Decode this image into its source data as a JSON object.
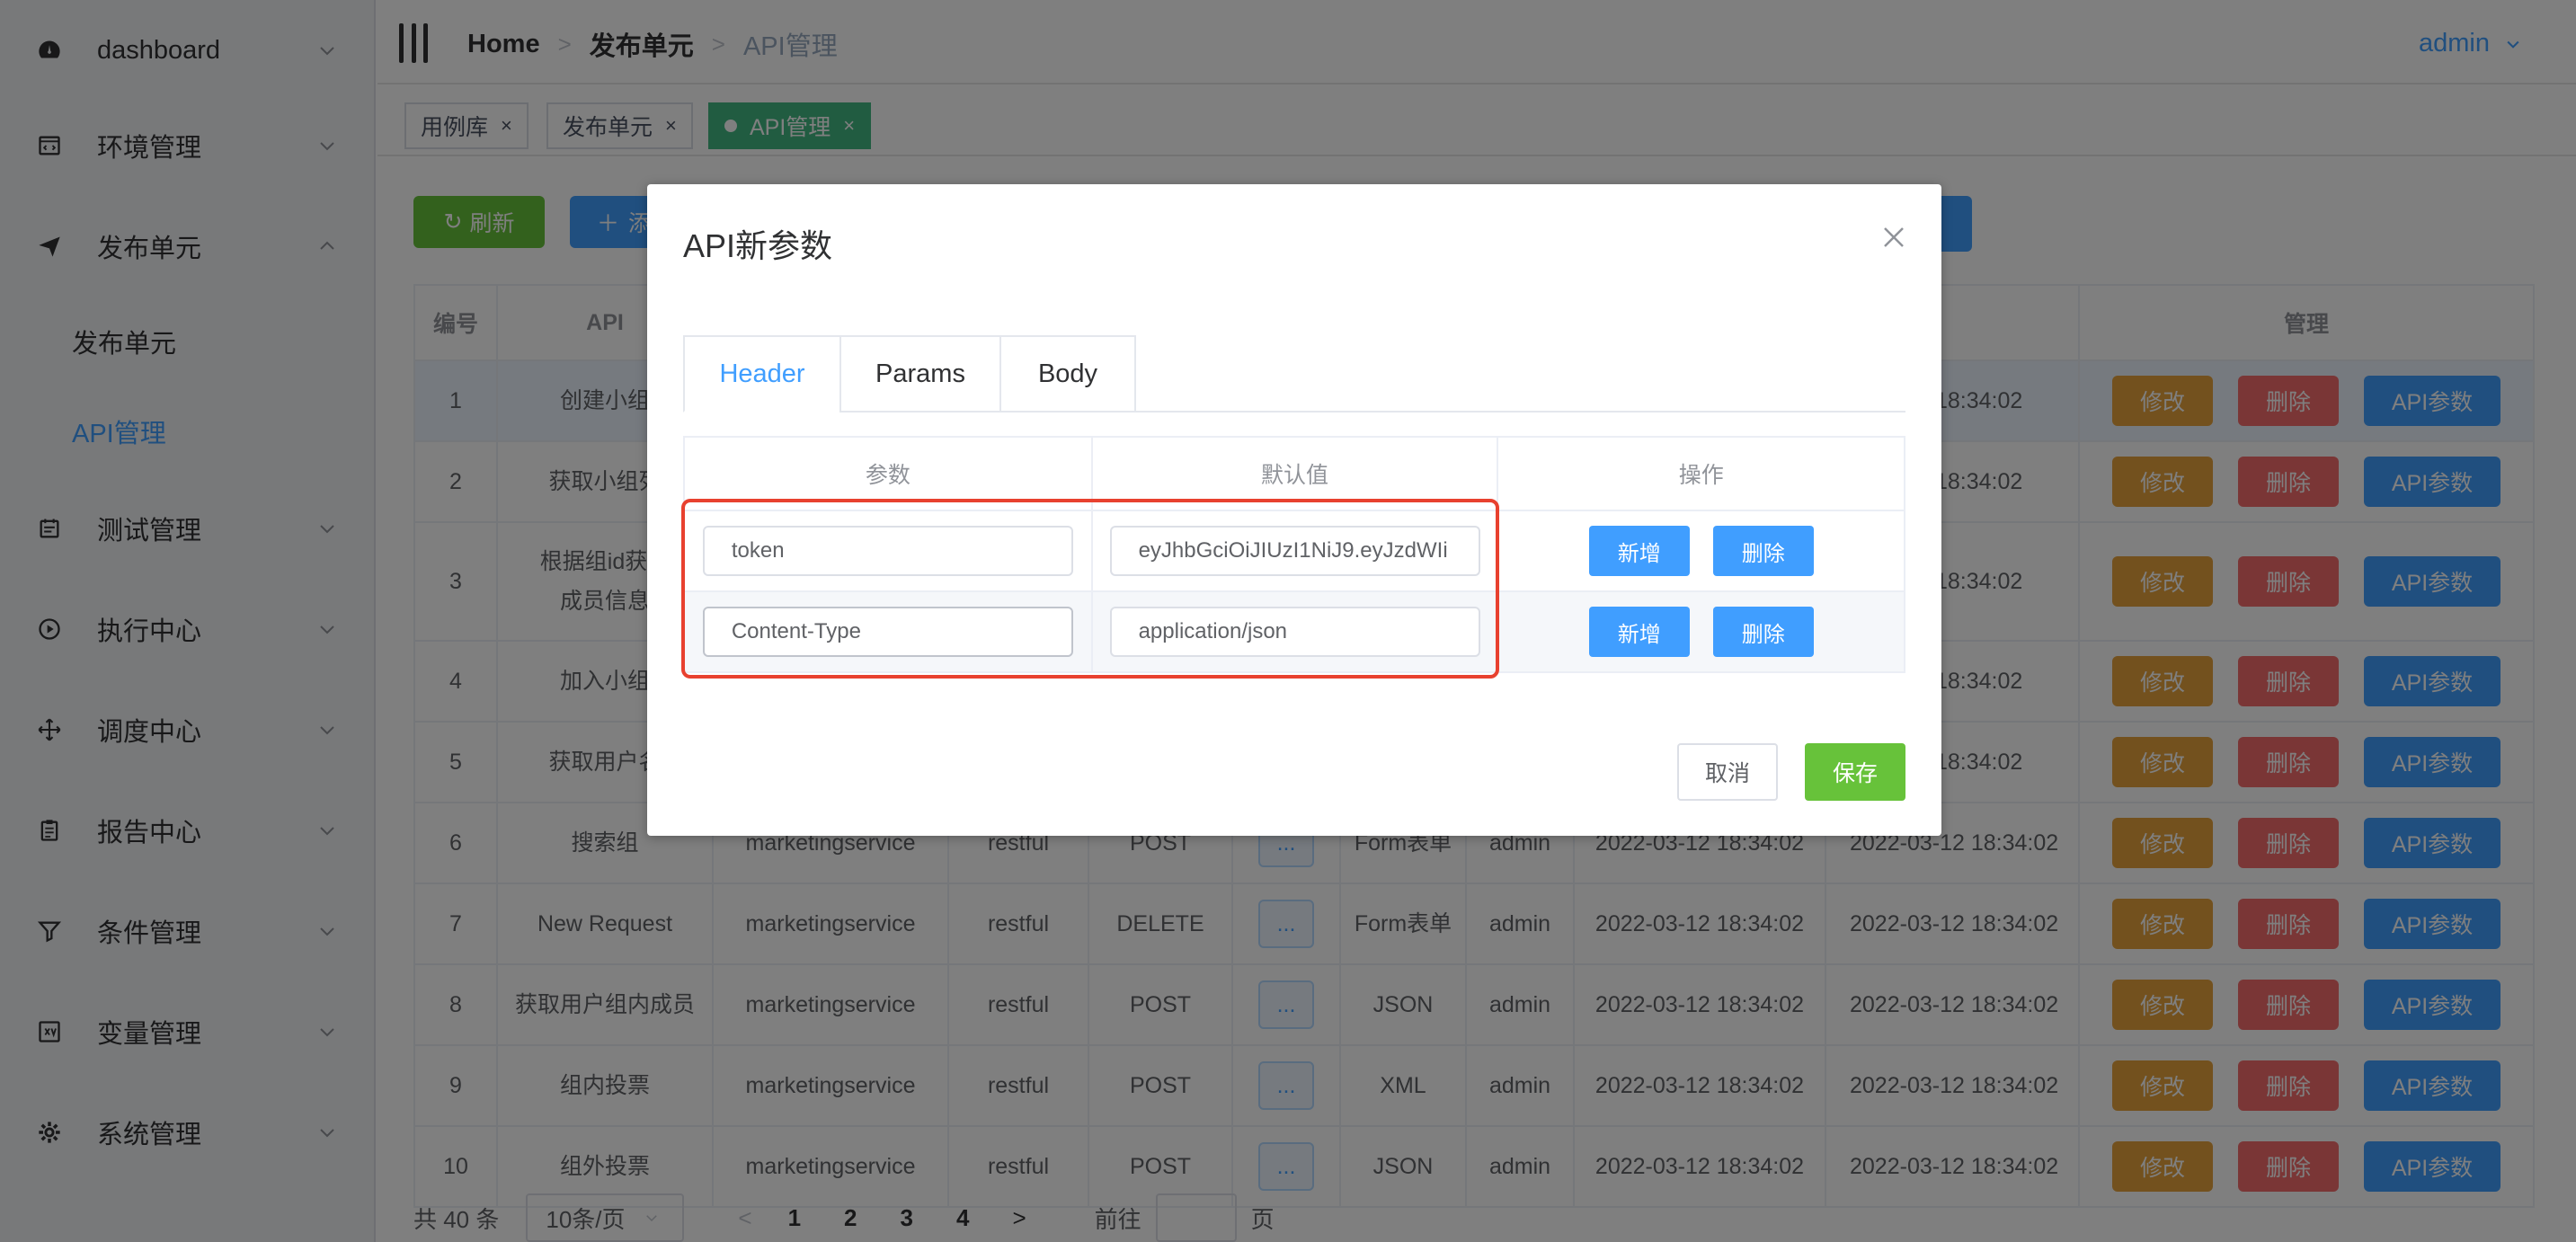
{
  "sidebar": {
    "menu": [
      {
        "label": "dashboard",
        "icon": "dashboard-icon"
      },
      {
        "label": "环境管理",
        "icon": "code-window-icon"
      },
      {
        "label": "发布单元",
        "icon": "send-icon"
      },
      {
        "label": "测试管理",
        "icon": "calendar-icon"
      },
      {
        "label": "执行中心",
        "icon": "play-circle-icon"
      },
      {
        "label": "调度中心",
        "icon": "move-arrows-icon"
      },
      {
        "label": "报告中心",
        "icon": "clipboard-icon"
      },
      {
        "label": "条件管理",
        "icon": "filter-icon"
      },
      {
        "label": "变量管理",
        "icon": "variable-box-icon"
      },
      {
        "label": "系统管理",
        "icon": "gear-icon"
      }
    ],
    "submenu": [
      {
        "label": "发布单元"
      },
      {
        "label": "API管理"
      }
    ]
  },
  "header": {
    "breadcrumb": [
      "Home",
      "发布单元",
      "API管理"
    ],
    "user": "admin"
  },
  "tags": [
    {
      "label": "用例库"
    },
    {
      "label": "发布单元"
    },
    {
      "label": "API管理"
    }
  ],
  "toolbar": {
    "refresh": "刷新",
    "add": "添"
  },
  "table": {
    "headers": [
      "编号",
      "API",
      "",
      "",
      "",
      "",
      "",
      "",
      "",
      "后修改时间",
      "管理"
    ],
    "rows": [
      {
        "id": "1",
        "api": "创建小组",
        "svc": "",
        "proto": "",
        "method": "",
        "more": "",
        "fmt": "",
        "user": "",
        "created": "",
        "modified": "3-12 18:34:02"
      },
      {
        "id": "2",
        "api": "获取小组列",
        "svc": "",
        "proto": "",
        "method": "",
        "more": "",
        "fmt": "",
        "user": "",
        "created": "",
        "modified": "3-12 18:34:02"
      },
      {
        "id": "3",
        "api": "根据组id获取\n成员信息",
        "svc": "",
        "proto": "",
        "method": "",
        "more": "",
        "fmt": "",
        "user": "",
        "created": "",
        "modified": "3-12 18:34:02"
      },
      {
        "id": "4",
        "api": "加入小组",
        "svc": "",
        "proto": "",
        "method": "",
        "more": "",
        "fmt": "",
        "user": "",
        "created": "",
        "modified": "3-12 18:34:02"
      },
      {
        "id": "5",
        "api": "获取用户名",
        "svc": "",
        "proto": "",
        "method": "",
        "more": "",
        "fmt": "",
        "user": "",
        "created": "",
        "modified": "3-12 18:34:02"
      },
      {
        "id": "6",
        "api": "搜索组",
        "svc": "marketingservice",
        "proto": "restful",
        "method": "POST",
        "more": "...",
        "fmt": "Form表单",
        "user": "admin",
        "created": "2022-03-12 18:34:02",
        "modified": "2022-03-12 18:34:02"
      },
      {
        "id": "7",
        "api": "New Request",
        "svc": "marketingservice",
        "proto": "restful",
        "method": "DELETE",
        "more": "...",
        "fmt": "Form表单",
        "user": "admin",
        "created": "2022-03-12 18:34:02",
        "modified": "2022-03-12 18:34:02"
      },
      {
        "id": "8",
        "api": "获取用户组内成员",
        "svc": "marketingservice",
        "proto": "restful",
        "method": "POST",
        "more": "...",
        "fmt": "JSON",
        "user": "admin",
        "created": "2022-03-12 18:34:02",
        "modified": "2022-03-12 18:34:02"
      },
      {
        "id": "9",
        "api": "组内投票",
        "svc": "marketingservice",
        "proto": "restful",
        "method": "POST",
        "more": "...",
        "fmt": "XML",
        "user": "admin",
        "created": "2022-03-12 18:34:02",
        "modified": "2022-03-12 18:34:02"
      },
      {
        "id": "10",
        "api": "组外投票",
        "svc": "marketingservice",
        "proto": "restful",
        "method": "POST",
        "more": "...",
        "fmt": "JSON",
        "user": "admin",
        "created": "2022-03-12 18:34:02",
        "modified": "2022-03-12 18:34:02"
      }
    ],
    "actions": {
      "edit": "修改",
      "delete": "删除",
      "params": "API参数"
    }
  },
  "pagination": {
    "total": "共 40 条",
    "page_size": "10条/页",
    "pages": [
      "1",
      "2",
      "3",
      "4"
    ],
    "goto_prefix": "前往",
    "goto_suffix": "页"
  },
  "dialog": {
    "title": "API新参数",
    "tabs": [
      "Header",
      "Params",
      "Body"
    ],
    "columns": [
      "参数",
      "默认值",
      "操作"
    ],
    "rows": [
      {
        "param": "token",
        "default": "eyJhbGciOiJIUzI1NiJ9.eyJzdWIi"
      },
      {
        "param": "Content-Type",
        "default": "application/json"
      }
    ],
    "row_actions": {
      "add": "新增",
      "delete": "删除"
    },
    "cancel": "取消",
    "save": "保存"
  },
  "colors": {
    "primary": "#409eff",
    "success": "#67c23a",
    "warning": "#e6a23c",
    "danger": "#f56c6c",
    "annotation": "#e8412f"
  }
}
